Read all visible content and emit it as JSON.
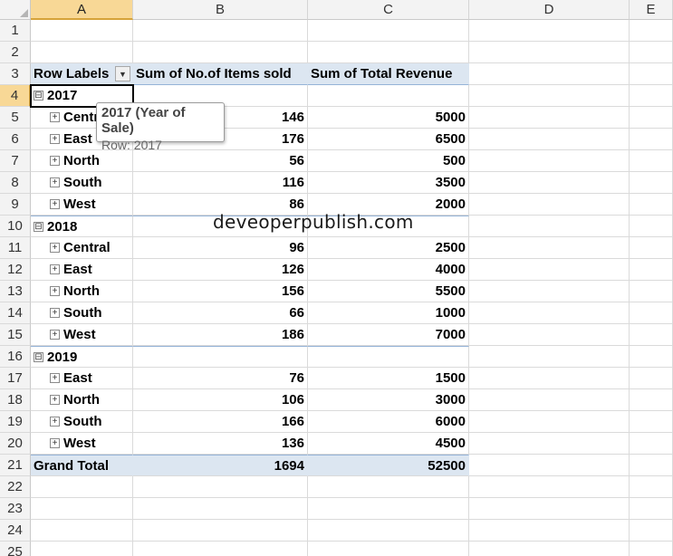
{
  "columns": [
    "A",
    "B",
    "C",
    "D",
    "E"
  ],
  "rows": [
    "1",
    "2",
    "3",
    "4",
    "5",
    "6",
    "7",
    "8",
    "9",
    "10",
    "11",
    "12",
    "13",
    "14",
    "15",
    "16",
    "17",
    "18",
    "19",
    "20",
    "21",
    "22",
    "23",
    "24",
    "25"
  ],
  "pivot": {
    "header": {
      "row_labels": "Row Labels",
      "items_sold": "Sum of No.of Items sold",
      "revenue": "Sum of Total Revenue",
      "filter_icon": "dropdown-arrow"
    },
    "groups": [
      {
        "year": "2017",
        "toggle": "⊟",
        "items": [
          {
            "region": "Central",
            "items_sold": "146",
            "revenue": "5000"
          },
          {
            "region": "East",
            "items_sold": "176",
            "revenue": "6500"
          },
          {
            "region": "North",
            "items_sold": "56",
            "revenue": "500"
          },
          {
            "region": "South",
            "items_sold": "116",
            "revenue": "3500"
          },
          {
            "region": "West",
            "items_sold": "86",
            "revenue": "2000"
          }
        ]
      },
      {
        "year": "2018",
        "toggle": "⊟",
        "items": [
          {
            "region": "Central",
            "items_sold": "96",
            "revenue": "2500"
          },
          {
            "region": "East",
            "items_sold": "126",
            "revenue": "4000"
          },
          {
            "region": "North",
            "items_sold": "156",
            "revenue": "5500"
          },
          {
            "region": "South",
            "items_sold": "66",
            "revenue": "1000"
          },
          {
            "region": "West",
            "items_sold": "186",
            "revenue": "7000"
          }
        ]
      },
      {
        "year": "2019",
        "toggle": "⊟",
        "items": [
          {
            "region": "East",
            "items_sold": "76",
            "revenue": "1500"
          },
          {
            "region": "North",
            "items_sold": "106",
            "revenue": "3000"
          },
          {
            "region": "South",
            "items_sold": "166",
            "revenue": "6000"
          },
          {
            "region": "West",
            "items_sold": "136",
            "revenue": "4500"
          }
        ]
      }
    ],
    "grand_total": {
      "label": "Grand Total",
      "items_sold": "1694",
      "revenue": "52500"
    }
  },
  "tooltip": {
    "title": "2017 (Year of Sale)",
    "subtitle": "Row: 2017"
  },
  "watermark": "deveoperpublish.com",
  "colors": {
    "pivot_band": "#dce6f1",
    "pivot_line": "#95b3d7",
    "selected_header": "#f8d896"
  }
}
